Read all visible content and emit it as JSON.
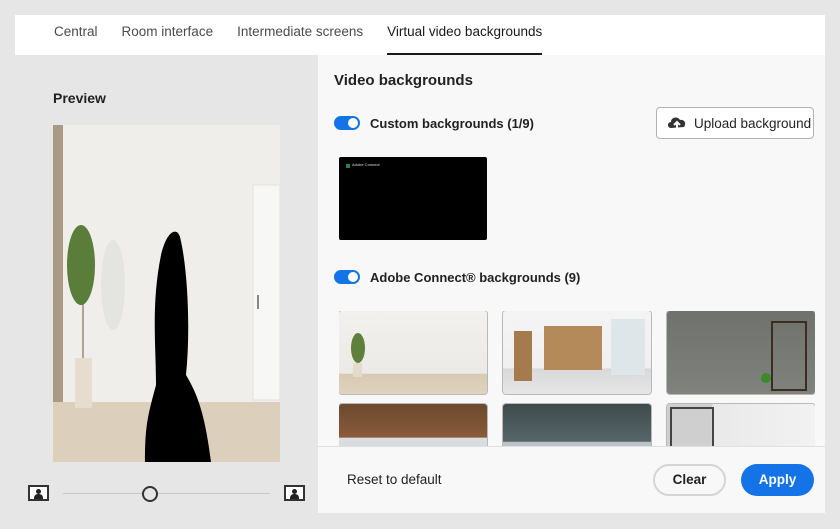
{
  "tabs": [
    {
      "label": "Central",
      "active": false
    },
    {
      "label": "Room interface",
      "active": false
    },
    {
      "label": "Intermediate screens",
      "active": false
    },
    {
      "label": "Virtual video backgrounds",
      "active": true
    }
  ],
  "preview": {
    "title": "Preview",
    "slider_value_percent": 42,
    "slider_left_icon": "person-image-small-icon",
    "slider_right_icon": "person-image-large-icon"
  },
  "video_backgrounds": {
    "title": "Video backgrounds",
    "custom": {
      "toggle_on": true,
      "label": "Custom backgrounds (1/9)",
      "upload_label": "Upload background",
      "upload_icon": "cloud-upload-icon",
      "thumbnails": [
        {
          "caption": "Adobe Connect"
        }
      ]
    },
    "adobe": {
      "toggle_on": true,
      "label": "Adobe Connect® backgrounds (9)",
      "thumbnails": [
        {
          "name": "white-room-plant"
        },
        {
          "name": "office-wood-wall"
        },
        {
          "name": "concrete-wall-shelf"
        },
        {
          "name": "loft-brick-windows"
        },
        {
          "name": "industrial-ceiling-office"
        },
        {
          "name": "white-room-glass-door"
        }
      ]
    }
  },
  "footer": {
    "reset_label": "Reset to default",
    "clear_label": "Clear",
    "apply_label": "Apply"
  },
  "colors": {
    "accent": "#1473e6"
  }
}
